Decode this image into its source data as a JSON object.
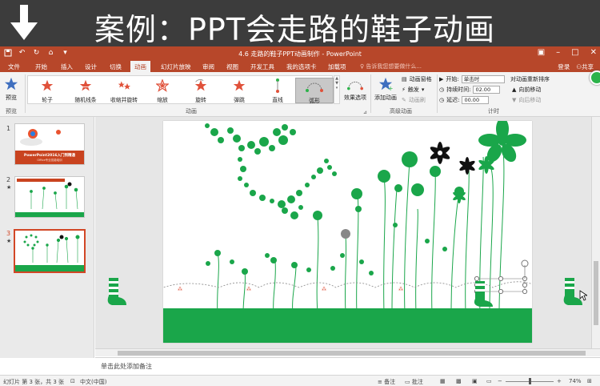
{
  "banner": {
    "title": "案例：PPT会走路的鞋子动画",
    "icon": "down-arrow-icon"
  },
  "window": {
    "title": "4.6 走路的鞋子PPT动画制作 - PowerPoint"
  },
  "tabs": [
    "文件",
    "开始",
    "插入",
    "设计",
    "切换",
    "动画",
    "幻灯片放映",
    "审阅",
    "视图",
    "开发工具",
    "我的选项卡",
    "加载项"
  ],
  "active_tab": "动画",
  "tell_me": "告诉我您想要做什么...",
  "account": {
    "login": "登录",
    "share": "共享"
  },
  "ribbon": {
    "preview_label": "预览",
    "preview_group": "预览",
    "animations": [
      "轮子",
      "随机线条",
      "收缩并旋转",
      "缩放",
      "旋转",
      "弹跳",
      "直线",
      "弧形"
    ],
    "selected_animation": "弧形",
    "effect_options": "效果选项",
    "animation_group": "动画",
    "add_animation": "添加动画",
    "animation_pane": "动画窗格",
    "trigger": "触发",
    "animation_painter": "动画刷",
    "advanced_group": "高级动画",
    "start_label": "开始:",
    "start_value": "单击时",
    "duration_label": "持续时间:",
    "duration_value": "02.00",
    "delay_label": "延迟:",
    "delay_value": "00.00",
    "reorder_title": "对动画重新排序",
    "move_earlier": "向前移动",
    "move_later": "向后移动",
    "timing_group": "计时"
  },
  "slides": [
    {
      "number": "1",
      "title": "PowerPoint2016入门到精通",
      "subtitle": "Office专业技能培训"
    },
    {
      "number": "2",
      "star": "★"
    },
    {
      "number": "3",
      "star": "★",
      "selected": true
    }
  ],
  "notes_placeholder": "单击此处添加备注",
  "status": {
    "slide_info": "幻灯片 第 3 张，共 3 张",
    "language": "中文(中国)",
    "notes": "备注",
    "comments": "批注",
    "zoom": "74%"
  },
  "colors": {
    "accent": "#b7472a",
    "green": "#1aa64a",
    "banner": "#3c3c3c"
  }
}
